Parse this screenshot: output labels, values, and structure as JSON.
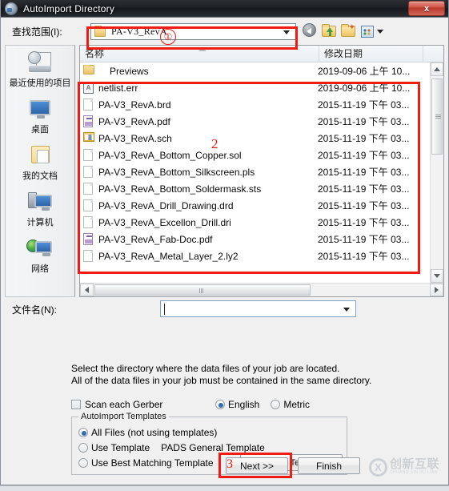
{
  "window": {
    "title": "AutoImport Directory",
    "close_label": "x",
    "icon": "app-globe-icon"
  },
  "lookin": {
    "label": "查找范围(I):",
    "value": "PA-V3_RevA",
    "folder_icon": "folder-icon",
    "dropdown_icon": "chevron-down-icon",
    "toolbar": [
      {
        "name": "back-button",
        "icon": "back-arrow-icon"
      },
      {
        "name": "up-one-level-button",
        "icon": "folder-up-icon"
      },
      {
        "name": "new-folder-button",
        "icon": "new-folder-icon"
      },
      {
        "name": "views-button",
        "icon": "views-grid-icon"
      }
    ]
  },
  "places": {
    "items": [
      {
        "label": "最近使用的项目",
        "icon": "recent-items-icon"
      },
      {
        "label": "桌面",
        "icon": "desktop-icon"
      },
      {
        "label": "我的文档",
        "icon": "my-documents-icon"
      },
      {
        "label": "计算机",
        "icon": "computer-icon"
      },
      {
        "label": "网络",
        "icon": "network-icon"
      }
    ]
  },
  "filelist": {
    "columns": {
      "name": "名称",
      "date": "修改日期"
    },
    "rows": [
      {
        "name": "Previews",
        "date": "2019-09-06 上午 10...",
        "icon": "folder-icon"
      },
      {
        "name": "netlist.err",
        "date": "2019-09-06 上午 10...",
        "icon": "err-file-icon"
      },
      {
        "name": "PA-V3_RevA.brd",
        "date": "2015-11-19 下午 03...",
        "icon": "document-icon"
      },
      {
        "name": "PA-V3_RevA.pdf",
        "date": "2015-11-19 下午 03...",
        "icon": "pdf-file-icon"
      },
      {
        "name": "PA-V3_RevA.sch",
        "date": "2015-11-19 下午 03...",
        "icon": "schematic-file-icon"
      },
      {
        "name": "PA-V3_RevA_Bottom_Copper.sol",
        "date": "2015-11-19 下午 03...",
        "icon": "document-icon"
      },
      {
        "name": "PA-V3_RevA_Bottom_Silkscreen.pls",
        "date": "2015-11-19 下午 03...",
        "icon": "document-icon"
      },
      {
        "name": "PA-V3_RevA_Bottom_Soldermask.sts",
        "date": "2015-11-19 下午 03...",
        "icon": "document-icon"
      },
      {
        "name": "PA-V3_RevA_Drill_Drawing.drd",
        "date": "2015-11-19 下午 03...",
        "icon": "document-icon"
      },
      {
        "name": "PA-V3_RevA_Excellon_Drill.dri",
        "date": "2015-11-19 下午 03...",
        "icon": "document-icon"
      },
      {
        "name": "PA-V3_RevA_Fab-Doc.pdf",
        "date": "2015-11-19 下午 03...",
        "icon": "pdf-file-icon"
      },
      {
        "name": "PA-V3_RevA_Metal_Layer_2.ly2",
        "date": "2015-11-19 下午 03...",
        "icon": "document-icon"
      }
    ]
  },
  "filename": {
    "label": "文件名(N):",
    "value": "",
    "dropdown_icon": "chevron-down-icon"
  },
  "description": {
    "line1": "Select the directory where the data files of your job are located.",
    "line2": "All of the data files in your job must be contained in the same directory."
  },
  "options": {
    "scan_each_gerber": {
      "label": "Scan each Gerber",
      "checked": false
    },
    "units": {
      "english": {
        "label": "English",
        "selected": true
      },
      "metric": {
        "label": "Metric",
        "selected": false
      }
    }
  },
  "templates_group": {
    "title": "AutoImport Templates",
    "all_files": {
      "label": "All Files (not using templates)",
      "selected": true
    },
    "use_template": {
      "label": "Use Template",
      "selected": false
    },
    "template_name": "PADS General Template",
    "use_best_matching": {
      "label": "Use Best Matching Template",
      "selected": false
    },
    "button_label": "AutoImport Templates..."
  },
  "footer": {
    "next_label": "Next  >>",
    "finish_label": "Finish"
  },
  "watermark": {
    "mark": "X",
    "cn": "创新互联",
    "en": "CHUANG XIN HU LIAN"
  },
  "annotations": {
    "one": "①",
    "two": "2",
    "three": "3",
    "color": "#ee1c12"
  }
}
